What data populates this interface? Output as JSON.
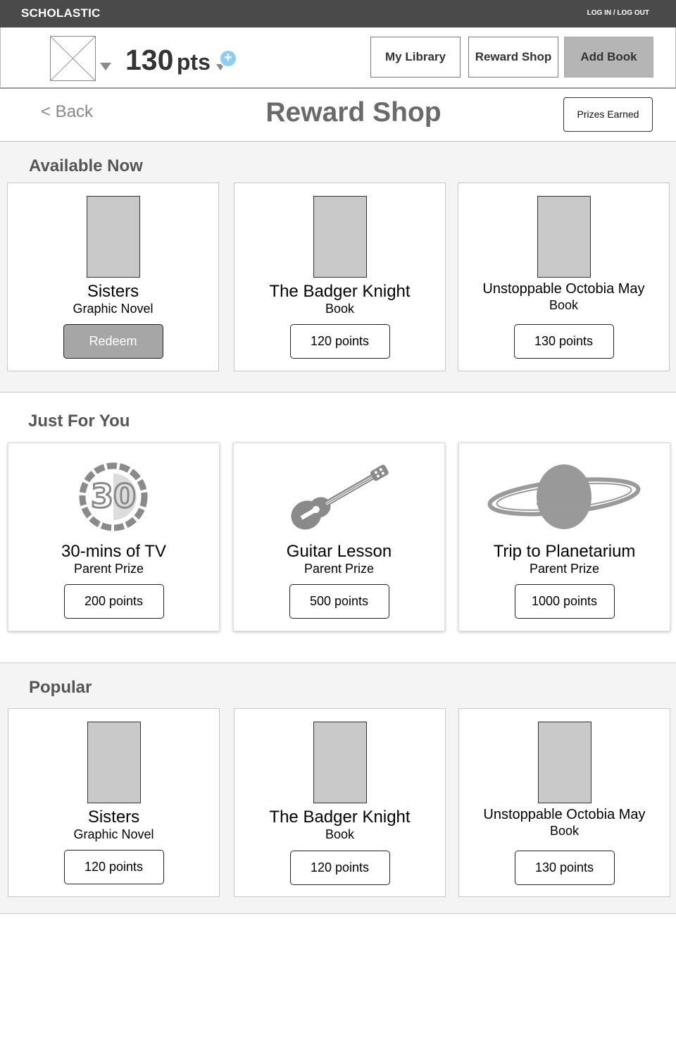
{
  "brand": "SCHOLASTIC",
  "auth_link": "LOG IN / LOG OUT",
  "header": {
    "points_value": "130",
    "points_unit": "pts",
    "add_points_symbol": "+",
    "nav": {
      "library": "My Library",
      "shop": "Reward Shop",
      "add_book": "Add Book"
    }
  },
  "titlebar": {
    "back": "< Back",
    "title": "Reward Shop",
    "prizes_earned": "Prizes Earned"
  },
  "sections": {
    "available": {
      "title": "Available Now",
      "items": [
        {
          "title": "Sisters",
          "subtitle": "Graphic Novel",
          "action": "Redeem"
        },
        {
          "title": "The Badger Knight",
          "subtitle": "Book",
          "action": "120 points"
        },
        {
          "title": "Unstoppable Octobia May",
          "subtitle": "Book",
          "action": "130 points"
        }
      ]
    },
    "for_you": {
      "title": "Just For You",
      "items": [
        {
          "title": "30-mins of TV",
          "subtitle": "Parent Prize",
          "action": "200 points",
          "icon": "tv-timer-icon"
        },
        {
          "title": "Guitar Lesson",
          "subtitle": "Parent Prize",
          "action": "500 points",
          "icon": "guitar-icon"
        },
        {
          "title": "Trip to Planetarium",
          "subtitle": "Parent Prize",
          "action": "1000 points",
          "icon": "planet-icon"
        }
      ]
    },
    "popular": {
      "title": "Popular",
      "items": [
        {
          "title": "Sisters",
          "subtitle": "Graphic Novel",
          "action": "120 points"
        },
        {
          "title": "The Badger Knight",
          "subtitle": "Book",
          "action": "120 points"
        },
        {
          "title": "Unstoppable Octobia May",
          "subtitle": "Book",
          "action": "130 points"
        }
      ]
    }
  },
  "colors": {
    "topbar": "#4a4a4a",
    "section_bg": "#f4f4f4",
    "redeem_button": "#a6a6a6",
    "add_points": "#8ecdf3",
    "title_text": "#6a6a6a"
  }
}
